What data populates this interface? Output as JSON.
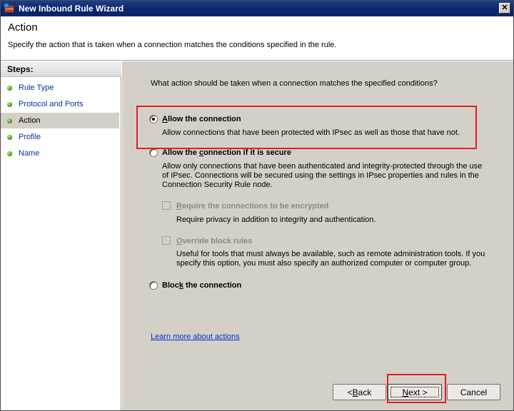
{
  "window": {
    "title": "New Inbound Rule Wizard",
    "close_glyph": "✕"
  },
  "header": {
    "title": "Action",
    "description": "Specify the action that is taken when a connection matches the conditions specified in the rule."
  },
  "steps": {
    "heading": "Steps:",
    "items": [
      {
        "label": "Rule Type"
      },
      {
        "label": "Protocol and Ports"
      },
      {
        "label": "Action"
      },
      {
        "label": "Profile"
      },
      {
        "label": "Name"
      }
    ],
    "active_index": 2
  },
  "main": {
    "question": "What action should be taken when a connection matches the specified conditions?",
    "options": [
      {
        "label_pre": "",
        "label_ul": "A",
        "label_post": "llow the connection",
        "description": "Allow connections that have been protected with IPsec as well as those that have not.",
        "checked": true
      },
      {
        "label_pre": "Allow the ",
        "label_ul": "c",
        "label_post": "onnection if it is secure",
        "description_lines": [
          "Allow only connections that have been authenticated and integrity-protected through the use",
          "of IPsec.  Connections will be secured using the settings in IPsec properties and rules in the",
          "Connection Security Rule node."
        ],
        "checked": false
      },
      {
        "label_pre": "Bloc",
        "label_ul": "k",
        "label_post": " the connection",
        "checked": false
      }
    ],
    "sub_options": [
      {
        "label_ul": "R",
        "label_post": "equire the connections to be encrypted",
        "description": "Require privacy in addition to integrity and authentication.",
        "checked": false
      },
      {
        "label_ul": "O",
        "label_post": "verride block rules",
        "description_lines": [
          "Useful for tools that must always be available, such as remote administration tools.  If you",
          "specify this option, you must also specify an authorized computer or computer group."
        ],
        "checked": false
      }
    ],
    "learn_more": "Learn more about actions"
  },
  "buttons": {
    "back_pre": "< ",
    "back_ul": "B",
    "back_post": "ack",
    "next_ul": "N",
    "next_post": "ext >",
    "cancel": "Cancel"
  },
  "colors": {
    "highlight": "#e02020",
    "titlebar": "#0a246a",
    "panel": "#d4d0c8",
    "link": "#0033cc"
  }
}
